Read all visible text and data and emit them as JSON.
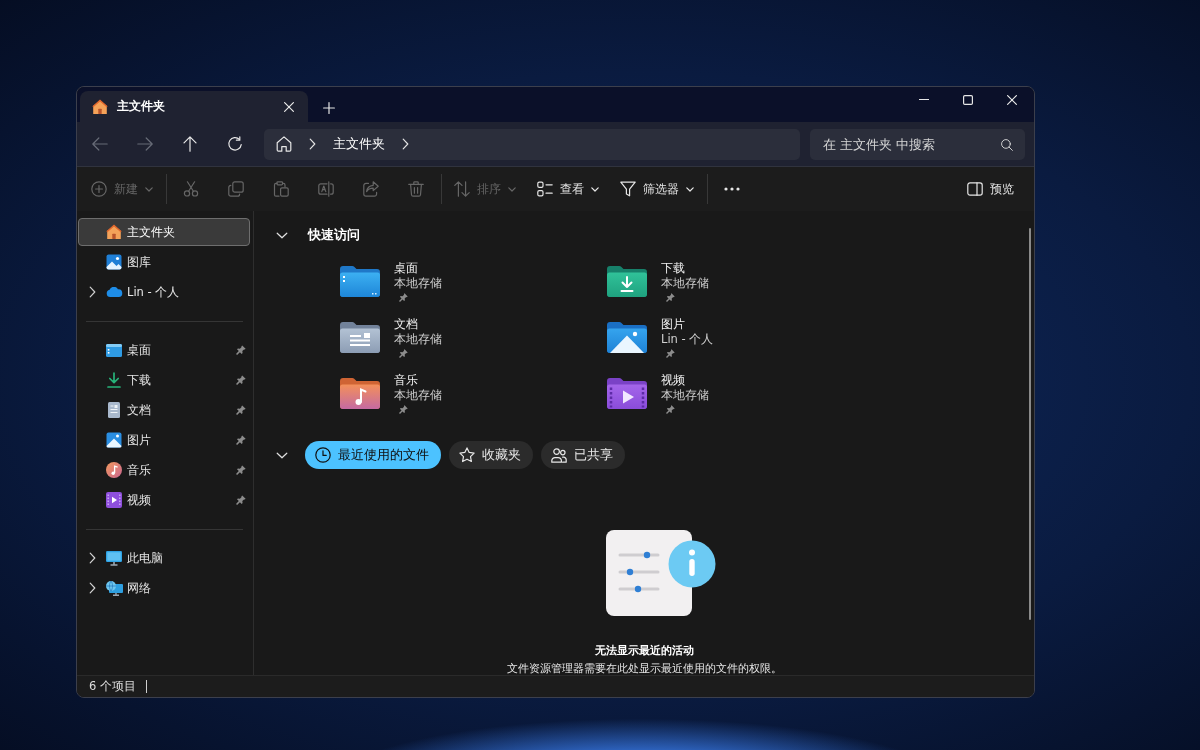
{
  "tabs": [
    {
      "label": "主文件夹",
      "selected": true
    }
  ],
  "navigation": {
    "buttons": [
      {
        "disabled": true
      },
      {
        "disabled": true
      },
      {
        "disabled": false
      },
      {
        "disabled": false
      }
    ],
    "address_segments": [
      "主文件夹"
    ],
    "search": {
      "placeholder": "在 主文件夹 中搜索"
    }
  },
  "toolbar": {
    "groups": [
      {
        "items": [
          {
            "label": "新建",
            "disabled": true,
            "dropdown": true
          }
        ]
      },
      {
        "items": [
          {
            "disabled": true
          },
          {
            "disabled": true
          },
          {
            "disabled": true
          },
          {
            "disabled": true
          },
          {
            "disabled": true
          },
          {
            "disabled": true
          }
        ]
      },
      {
        "items": [
          {
            "label": "排序",
            "disabled": true,
            "dropdown": true
          },
          {
            "label": "查看",
            "disabled": false,
            "dropdown": true
          },
          {
            "label": "筛选器",
            "disabled": false,
            "dropdown": true
          }
        ]
      },
      {
        "items": [
          {
            "disabled": false
          }
        ]
      }
    ],
    "right": [
      {
        "label": "预览",
        "disabled": false
      }
    ]
  },
  "sidebar": {
    "groups": [
      {
        "items": [
          {
            "label": "主文件夹",
            "selected": true
          },
          {
            "label": "图库",
            "selected": false
          },
          {
            "label": "Lin - 个人",
            "selected": false,
            "expanded": false
          }
        ]
      },
      {
        "items": [
          {
            "label": "桌面",
            "selected": false,
            "pinned": true
          },
          {
            "label": "下载",
            "selected": false,
            "pinned": true
          },
          {
            "label": "文档",
            "selected": false,
            "pinned": true
          },
          {
            "label": "图片",
            "selected": false,
            "pinned": true
          },
          {
            "label": "音乐",
            "selected": false,
            "pinned": true
          },
          {
            "label": "视频",
            "selected": false,
            "pinned": true
          }
        ]
      },
      {
        "items": [
          {
            "label": "此电脑",
            "selected": false,
            "expanded": false
          },
          {
            "label": "网络",
            "selected": false,
            "expanded": false
          }
        ]
      }
    ]
  },
  "quick_access": {
    "title": "快速访问",
    "expanded": true,
    "items": [
      {
        "name": "桌面",
        "location": "本地存储",
        "pinned": true
      },
      {
        "name": "下载",
        "location": "本地存储",
        "pinned": true
      },
      {
        "name": "文档",
        "location": "本地存储",
        "pinned": true
      },
      {
        "name": "图片",
        "location": "Lin - 个人",
        "pinned": true
      },
      {
        "name": "音乐",
        "location": "本地存储",
        "pinned": true
      },
      {
        "name": "视频",
        "location": "本地存储",
        "pinned": true
      }
    ]
  },
  "recent": {
    "expanded": true,
    "filters": [
      {
        "label": "最近使用的文件",
        "selected": true
      },
      {
        "label": "收藏夹",
        "selected": false
      },
      {
        "label": "已共享",
        "selected": false
      }
    ],
    "empty_state": {
      "title": "无法显示最近的活动",
      "message": "文件资源管理器需要在此处显示最近使用的文件的权限。"
    }
  },
  "status_bar": {
    "item_count": "6 个项目"
  }
}
